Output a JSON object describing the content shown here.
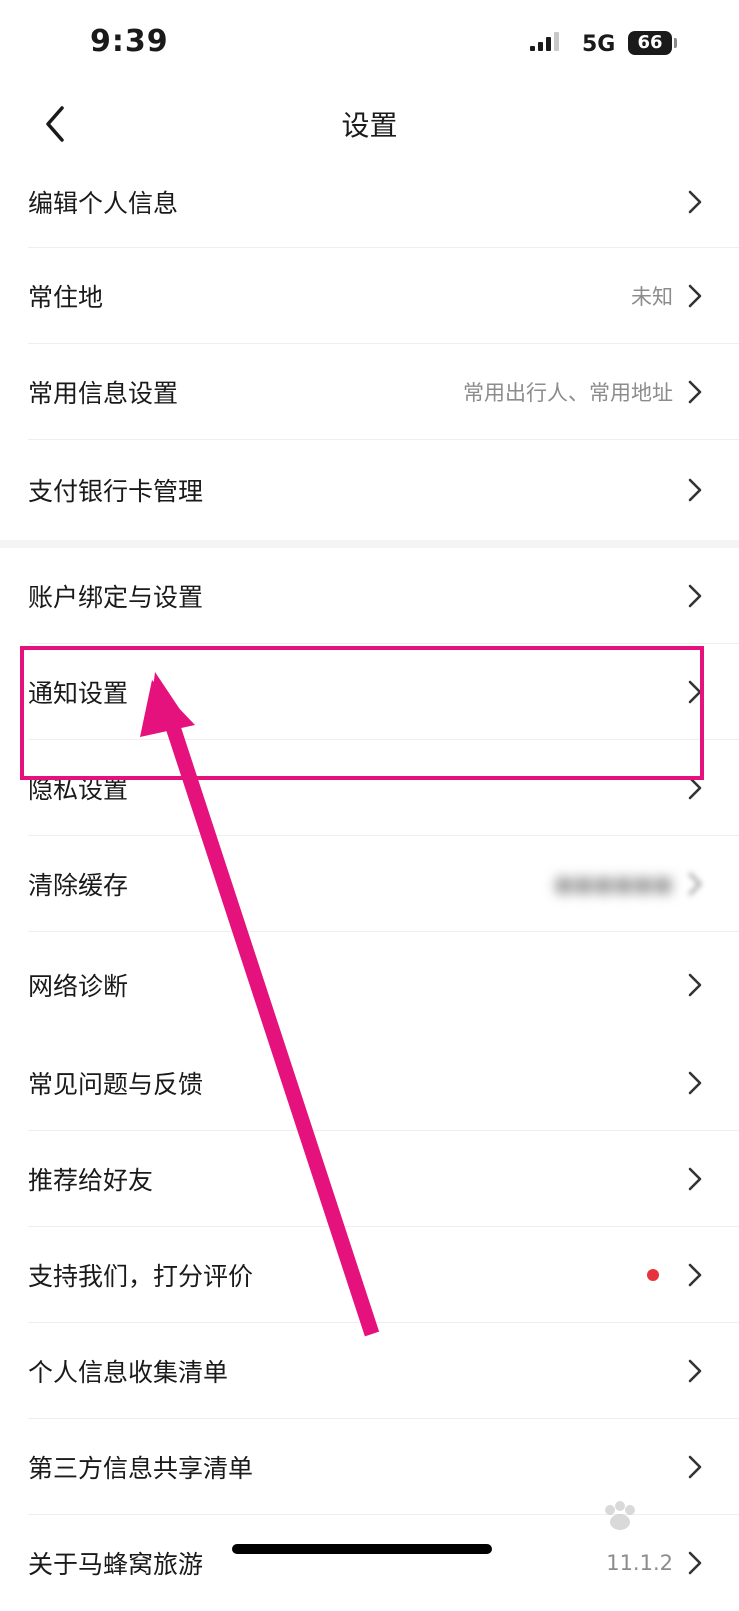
{
  "status": {
    "time": "9:39",
    "network": "5G",
    "battery": "66"
  },
  "header": {
    "title": "设置"
  },
  "groups": [
    {
      "items": [
        {
          "label": "编辑个人信息",
          "value": ""
        },
        {
          "label": "常住地",
          "value": "未知"
        },
        {
          "label": "常用信息设置",
          "value": "常用出行人、常用地址"
        },
        {
          "label": "支付银行卡管理",
          "value": ""
        }
      ]
    },
    {
      "items": [
        {
          "label": "账户绑定与设置",
          "value": ""
        },
        {
          "label": "通知设置",
          "value": ""
        },
        {
          "label": "隐私设置",
          "value": ""
        },
        {
          "label": "清除缓存",
          "value": ""
        },
        {
          "label": "网络诊断",
          "value": ""
        }
      ]
    },
    {
      "items": [
        {
          "label": "常见问题与反馈",
          "value": ""
        },
        {
          "label": "推荐给好友",
          "value": ""
        },
        {
          "label": "支持我们，打分评价",
          "value": "",
          "badge": "red-dot"
        },
        {
          "label": "个人信息收集清单",
          "value": ""
        },
        {
          "label": "第三方信息共享清单",
          "value": ""
        },
        {
          "label": "关于马蜂窝旅游",
          "value": "11.1.2"
        }
      ]
    }
  ],
  "colors": {
    "accent_annotation": "#e5127d",
    "badge_dot": "#e8323c"
  },
  "icons": {
    "back": "chevron-left-icon",
    "row": "chevron-right-icon"
  }
}
